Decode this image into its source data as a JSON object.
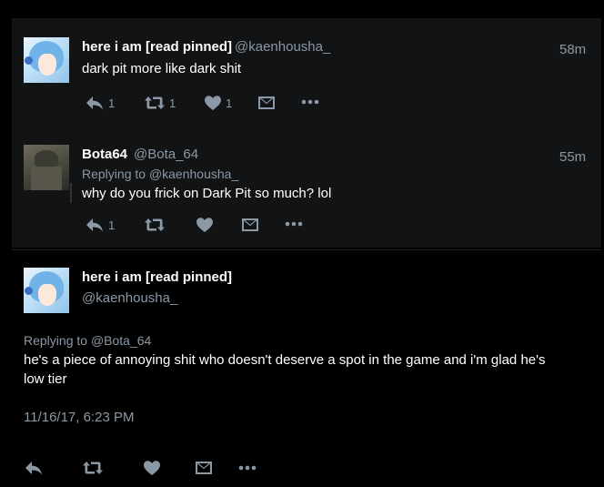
{
  "thread": {
    "tweet1": {
      "name": "here i am [read pinned]",
      "handle": "@kaenhousha_",
      "time": "58m",
      "text": "dark pit more like dark shit",
      "reply_count": "1",
      "retweet_count": "1",
      "like_count": "1"
    },
    "tweet2": {
      "name": "Bota64",
      "handle": "@Bota_64",
      "time": "55m",
      "replying_prefix": "Replying to",
      "replying_to": "@kaenhousha_",
      "text": "why do you frick on Dark Pit so much? lol",
      "reply_count": "1"
    }
  },
  "main_tweet": {
    "name": "here i am [read pinned]",
    "handle": "@kaenhousha_",
    "replying_prefix": "Replying to",
    "replying_to": "@Bota_64",
    "text_line1": "he's a piece of annoying shit who doesn't deserve a spot in the game and i'm glad he's",
    "text_line2": "low tier",
    "timestamp": "11/16/17, 6:23 PM"
  },
  "icons": {
    "reply": "reply-icon",
    "retweet": "retweet-icon",
    "like": "heart-icon",
    "dm": "envelope-icon",
    "more": "more-icon"
  },
  "colors": {
    "background": "#000000",
    "card": "#111315",
    "secondary_text": "#8b98a5"
  }
}
